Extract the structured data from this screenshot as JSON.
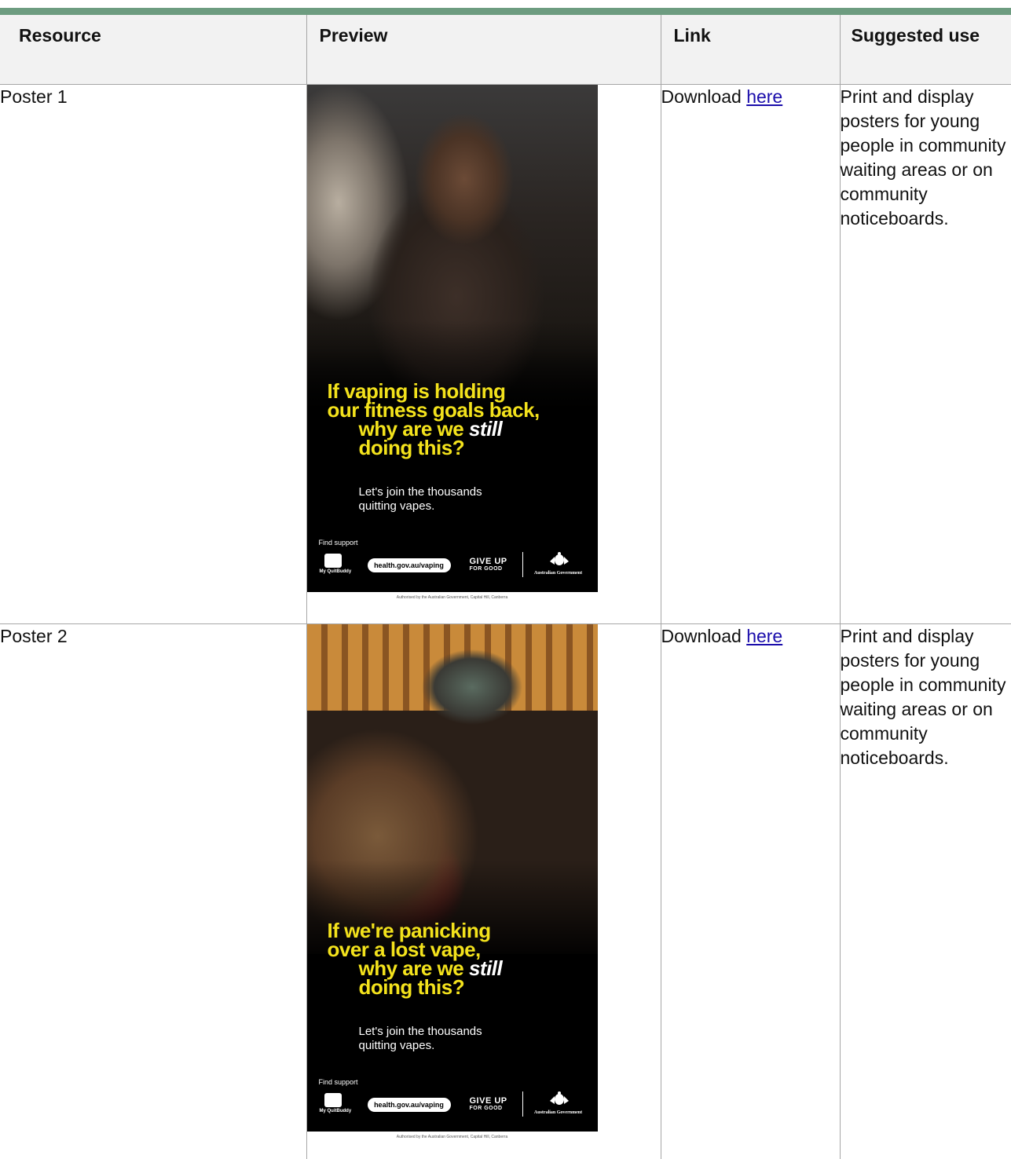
{
  "table": {
    "headers": {
      "resource": "Resource",
      "preview": "Preview",
      "link": "Link",
      "suggested_use": "Suggested use"
    },
    "rows": [
      {
        "resource": "Poster 1",
        "link_prefix": "Download",
        "link_text": "here",
        "suggested_use": "Print and display posters for young people in community waiting areas or on community noticeboards.",
        "poster": {
          "headline_l1": "If vaping is holding",
          "headline_l2": "our fitness goals back,",
          "headline_l3": "why are we",
          "headline_em": "still",
          "headline_l4": "doing this?",
          "sub_l1": "Let's join the thousands",
          "sub_l2": "quitting vapes.",
          "find_support": "Find support",
          "app_name": "My QuitBuddy",
          "url": "health.gov.au/vaping",
          "giveup_l1": "GIVE UP",
          "giveup_l2": "FOR GOOD",
          "gov": "Australian Government",
          "authorised": "Authorised by the Australian Government, Capital Hill, Canberra"
        }
      },
      {
        "resource": "Poster 2",
        "link_prefix": "Download",
        "link_text": "here",
        "suggested_use": "Print and display posters for young people in community waiting areas or on community noticeboards.",
        "poster": {
          "headline_l1": "If we're panicking",
          "headline_l2": "over a lost vape,",
          "headline_l3": "why are we",
          "headline_em": "still",
          "headline_l4": "doing this?",
          "sub_l1": "Let's join the thousands",
          "sub_l2": "quitting vapes.",
          "find_support": "Find support",
          "app_name": "My QuitBuddy",
          "url": "health.gov.au/vaping",
          "giveup_l1": "GIVE UP",
          "giveup_l2": "FOR GOOD",
          "gov": "Australian Government",
          "authorised": "Authorised by the Australian Government, Capital Hill, Canberra"
        }
      }
    ]
  },
  "colors": {
    "header_bar": "#6d9c80",
    "header_bg": "#f2f2f2",
    "link": "#1a0dab",
    "poster_headline": "#f3e21c"
  }
}
